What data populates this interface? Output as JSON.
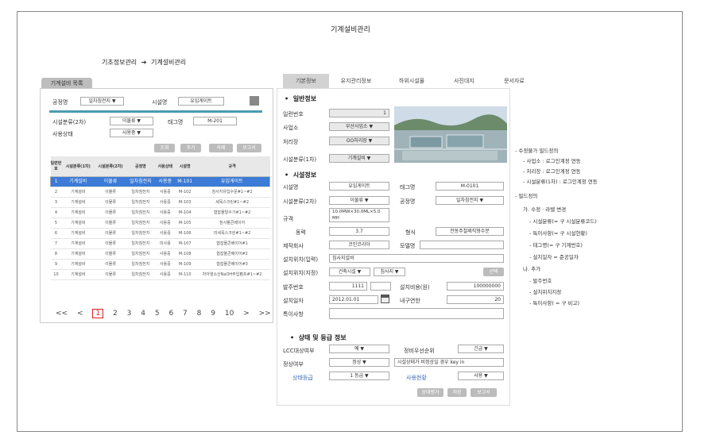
{
  "page_title": "기계설비관리",
  "breadcrumb": {
    "root": "기초정보관리",
    "arrow": "➔",
    "current": "기계설비관리"
  },
  "left": {
    "tab": "기계설비 목록",
    "filter": {
      "plant_label": "공정명",
      "plant_value": "일차침전지 ▼",
      "facility_label": "시설명",
      "facility_value": "유입게이트",
      "class2_label": "시설분류(2차)",
      "class2_value": "이물류 ▼",
      "tag_label": "태그명",
      "tag_value": "M-201",
      "status_label": "사용상태",
      "status_value": "사용중 ▼"
    },
    "buttons": {
      "search": "조회",
      "add": "추가",
      "delete": "삭제",
      "report": "보고서"
    },
    "columns": [
      "일련번호",
      "시설분류(1차)",
      "시설분류(2차)",
      "공정명",
      "사용상태",
      "시설명",
      "규격"
    ],
    "rows": [
      [
        "1",
        "기계설비",
        "이물류",
        "일차침전지",
        "사용중",
        "M-101",
        "유입게이트"
      ],
      [
        "2",
        "기계설비",
        "이물류",
        "일차침전지",
        "사용중",
        "M-102",
        "침사지유입수문#1~#2"
      ],
      [
        "3",
        "기계설비",
        "이물류",
        "일차침전지",
        "사용중",
        "M-103",
        "세목스크린#1~#2"
      ],
      [
        "4",
        "기계설비",
        "이물류",
        "일차침전지",
        "사용중",
        "M-104",
        "협잡물탈수기#1~#2"
      ],
      [
        "5",
        "기계설비",
        "이물류",
        "일차침전지",
        "사용중",
        "M-105",
        "침사물콘베이어"
      ],
      [
        "6",
        "기계설비",
        "이물류",
        "일차침전지",
        "사용중",
        "M-106",
        "미세목스크린#1~#2"
      ],
      [
        "7",
        "기계설비",
        "이물류",
        "일차침전지",
        "미사용",
        "M-107",
        "협잡물콘베이어#1"
      ],
      [
        "8",
        "기계설비",
        "이물류",
        "일차침전지",
        "사용중",
        "M-108",
        "협잡물콘베이어#2"
      ],
      [
        "9",
        "기계설비",
        "이물류",
        "일차침전지",
        "사용중",
        "M-109",
        "협잡물콘베이어#3"
      ],
      [
        "10",
        "기계설비",
        "이물류",
        "일차침전지",
        "사용중",
        "M-110",
        "차아염소산NaOH주입펌프#1~#2"
      ]
    ],
    "pager": {
      "first": "<<",
      "prev": "<",
      "pages": [
        "1",
        "2",
        "3",
        "4",
        "5",
        "6",
        "7",
        "8",
        "9",
        "10"
      ],
      "next": ">",
      "last": ">>"
    }
  },
  "right": {
    "tabs": [
      "기본정보",
      "유지관리정보",
      "하위시설물",
      "사진대지",
      "문서자료"
    ],
    "general": {
      "title": "일반정보",
      "serial_label": "일련번호",
      "serial_value": "1",
      "office_label": "사업소",
      "office_value": "부산사업소 ▼",
      "plant_label": "처리장",
      "plant_value": "OO처리장 ▼",
      "class1_label": "시설분류(1차)",
      "class1_value": "기계설비 ▼"
    },
    "facility": {
      "title": "시설정보",
      "name_label": "시설명",
      "name_value": "유입게이트",
      "tag_label": "태그명",
      "tag_value": "M-0101",
      "class2_label": "시설분류(2차)",
      "class2_value": "이물류 ▼",
      "process_label": "공정명",
      "process_value": "일차침전지 ▼",
      "spec_label": "규격",
      "spec_value": "10.0MW×30.0ML×5.0 MH",
      "power_label": "동력",
      "power_value": "3.7",
      "type_label": "형식",
      "type_value": "전동주철제직형수문",
      "maker_label": "제작회사",
      "maker_value": "코인코리아",
      "model_label": "모델명",
      "model_value": "",
      "loc_input_label": "설치위치(입력)",
      "loc_input_value": "침사지설비",
      "loc_select_label": "설치위치(지정)",
      "loc_select_1": "건축시설 ▼",
      "loc_select_2": "침사지 ▼",
      "loc_select_btn": "선택",
      "order_label": "발주번호",
      "order_value": "1111",
      "cost_label": "설치비용(원)",
      "cost_value": "100000000",
      "date_label": "설치일자",
      "date_value": "2012.01.01",
      "life_label": "내구연한",
      "life_value": "20",
      "remark_label": "특이사항",
      "remark_value": ""
    },
    "state": {
      "title": "상태 및 등급 정보",
      "lcc_label": "LCC대상여부",
      "lcc_value": "예 ▼",
      "priority_label": "정비우선순위",
      "priority_value": "긴급 ▼",
      "normal_label": "정상여부",
      "normal_value": "정상 ▼",
      "normal_note": "시설상태가 비정상일 경우 key in",
      "grade_label": "상태등급",
      "grade_value": "1 등급 ▼",
      "usage_label": "사용현황",
      "usage_value": "사용 ▼"
    },
    "buttons": {
      "evaluate": "상태평가",
      "save": "저장",
      "report": "보고서"
    }
  },
  "notes": [
    "- 수정불가 필드정의",
    "- 사업소 : 로그인계정 연동",
    "- 처리장 : 로그인계정 연동",
    "- 시설분류(1차) : 로그인계정 연동",
    "- 필드정의",
    "가. 수정 · 라벨 변경",
    "- 시설분류(= 구 시설분류코드)",
    "- 특이사항(= 구 시설현황)",
    "- 태그명(= 구 기계번호)",
    "- 설치일자 = 준공일자",
    "나. 추가",
    "- 발주번호",
    "- 설치위치지정",
    "- 특이사항( = 구 비고)"
  ]
}
